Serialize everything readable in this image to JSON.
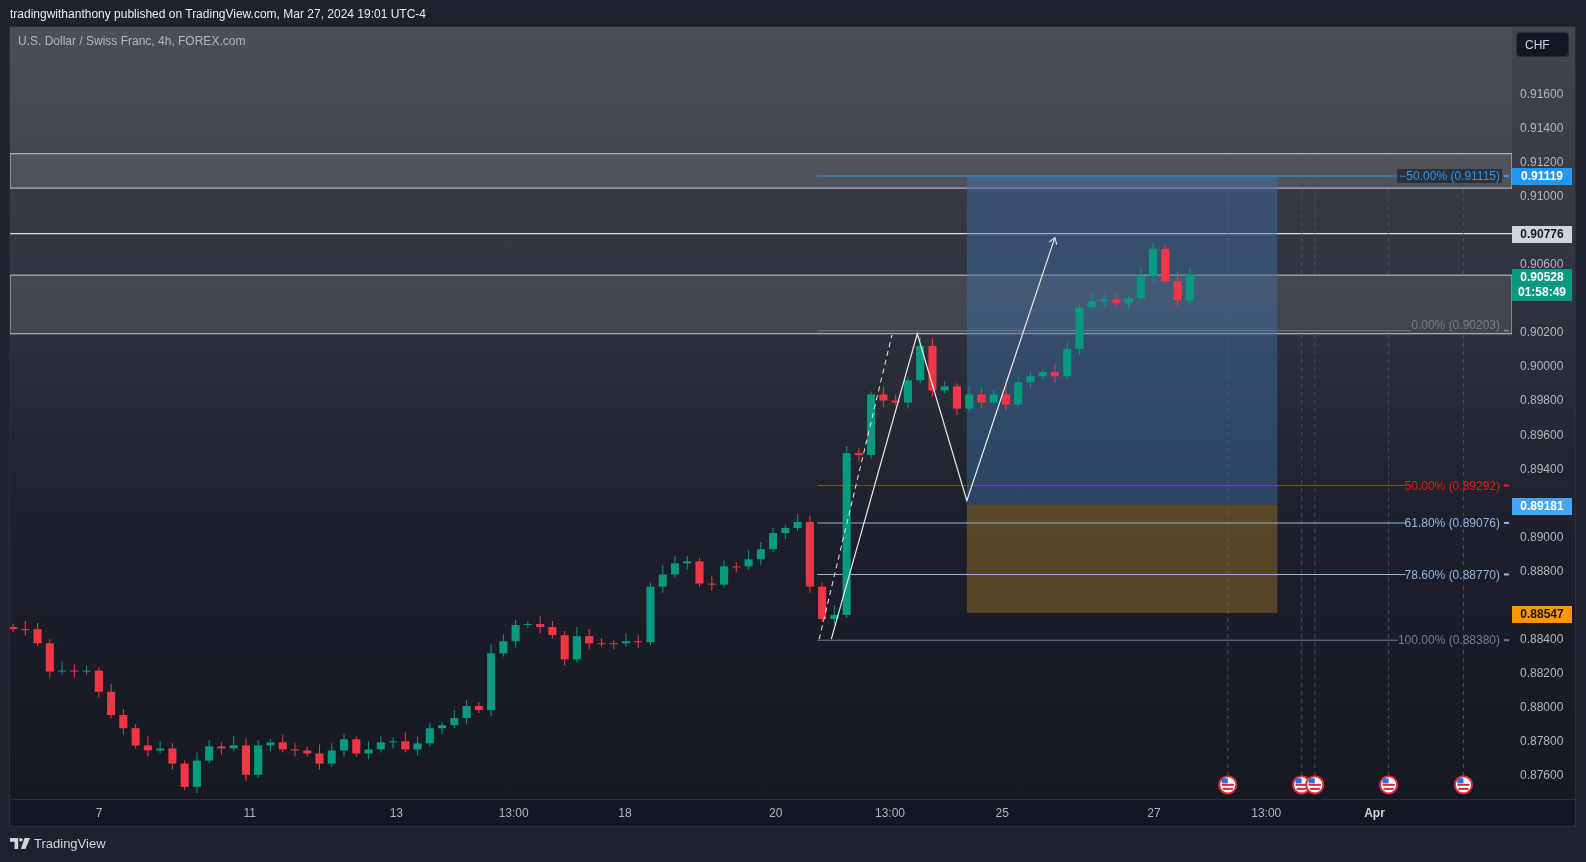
{
  "header": {
    "publication": "tradingwithanthony published on TradingView.com, Mar 27, 2024 19:01 UTC-4"
  },
  "chart": {
    "symbol_title": "U.S. Dollar / Swiss Franc, 4h, FOREX.com",
    "currency_button": "CHF",
    "fib_levels": [
      {
        "label": "−50.00% (0.91115)",
        "color": "#2196f3"
      },
      {
        "label": "0.00% (0.90203)",
        "color": "#787b86"
      },
      {
        "label": "50.00% (0.89292)",
        "color": "#e51c1c"
      },
      {
        "label": "61.80% (0.89076)",
        "color": "#90b4e6"
      },
      {
        "label": "78.60% (0.88770)",
        "color": "#90b4e6"
      },
      {
        "label": "100.00% (0.88380)",
        "color": "#787b86"
      }
    ],
    "price_ticks": [
      "0.91600",
      "0.91400",
      "0.91200",
      "0.91000",
      "0.90600",
      "0.90200",
      "0.90000",
      "0.89800",
      "0.89600",
      "0.89400",
      "0.89000",
      "0.88800",
      "0.88400",
      "0.88200",
      "0.88000",
      "0.87800",
      "0.87600"
    ],
    "price_badges": [
      {
        "text": "0.91119",
        "color": "#2196f3"
      },
      {
        "text": "0.90776",
        "color": "#d1d4dc"
      },
      {
        "text": "0.90528",
        "timer": "01:58:49",
        "color": "#089981"
      },
      {
        "text": "0.89181",
        "color": "#42a5f5"
      },
      {
        "text": "0.88547",
        "color": "#ff9800"
      }
    ],
    "time_ticks": [
      {
        "label": "7",
        "bold": false
      },
      {
        "label": "11",
        "bold": false
      },
      {
        "label": "13",
        "bold": false
      },
      {
        "label": "13:00",
        "bold": false
      },
      {
        "label": "18",
        "bold": false
      },
      {
        "label": "20",
        "bold": false
      },
      {
        "label": "13:00",
        "bold": false
      },
      {
        "label": "25",
        "bold": false
      },
      {
        "label": "27",
        "bold": false
      },
      {
        "label": "13:00",
        "bold": false
      },
      {
        "label": "Apr",
        "bold": true
      }
    ]
  },
  "footer": {
    "brand": "TradingView"
  }
}
